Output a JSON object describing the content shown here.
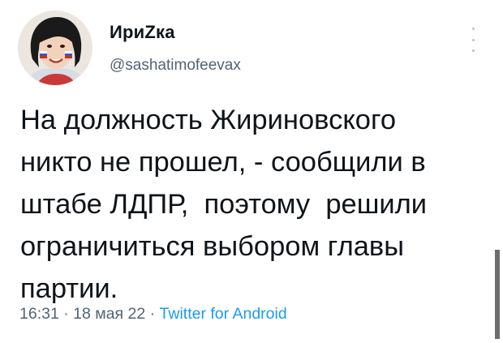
{
  "author": {
    "display_name": "ИриZка",
    "handle": "@sashatimofeevax",
    "avatar_icon": "user-avatar"
  },
  "menu": {
    "icon": "more-vertical-icon"
  },
  "tweet": {
    "lines": [
      "На должность Жириновского",
      "никто не прошел, - сообщили в",
      "штабе ЛДПР,  поэтому  решили",
      "ограничиться выбором главы",
      "партии."
    ]
  },
  "meta": {
    "time": "16:31",
    "sep1": " · ",
    "date": "18 мая 22",
    "sep2": " · ",
    "source": "Twitter for Android"
  },
  "colors": {
    "text": "#0f1419",
    "secondary": "#536471",
    "link": "#1d9bf0"
  }
}
